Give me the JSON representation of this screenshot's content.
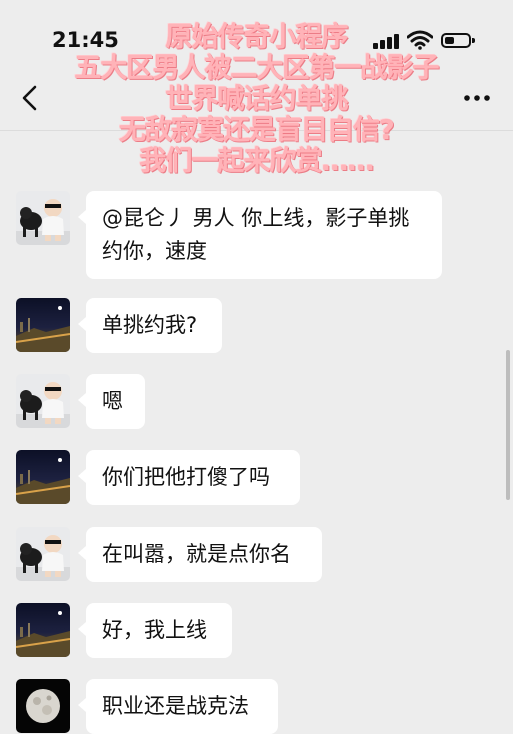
{
  "status_bar": {
    "time": "21:45"
  },
  "header": {
    "title": "",
    "overlay_lines": [
      "原始传奇小程序",
      "五大区男人被二大区第一战影子",
      "世界喊话约单挑",
      "无敌寂寞还是盲目自信?",
      "我们一起来欣赏……"
    ]
  },
  "messages": [
    {
      "sender": "dog",
      "text_lines": [
        "@昆仑丿 男人 你上线，影子单挑",
        "约你，速度"
      ]
    },
    {
      "sender": "night",
      "text_lines": [
        "单挑约我?"
      ]
    },
    {
      "sender": "dog",
      "text_lines": [
        "嗯"
      ]
    },
    {
      "sender": "night",
      "text_lines": [
        "你们把他打傻了吗"
      ]
    },
    {
      "sender": "dog",
      "text_lines": [
        "在叫嚣，就是点你名"
      ]
    },
    {
      "sender": "night",
      "text_lines": [
        "好，我上线"
      ]
    },
    {
      "sender": "moon",
      "text_lines": [
        "职业还是战克法"
      ]
    }
  ],
  "colors": {
    "background": "#ededed",
    "bubble": "#ffffff",
    "overlay_text": "#ffb3b8"
  },
  "icons": {
    "back": "chevron-left-icon",
    "more": "more-dots-icon",
    "signal": "signal-icon",
    "wifi": "wifi-icon",
    "battery": "battery-icon"
  }
}
